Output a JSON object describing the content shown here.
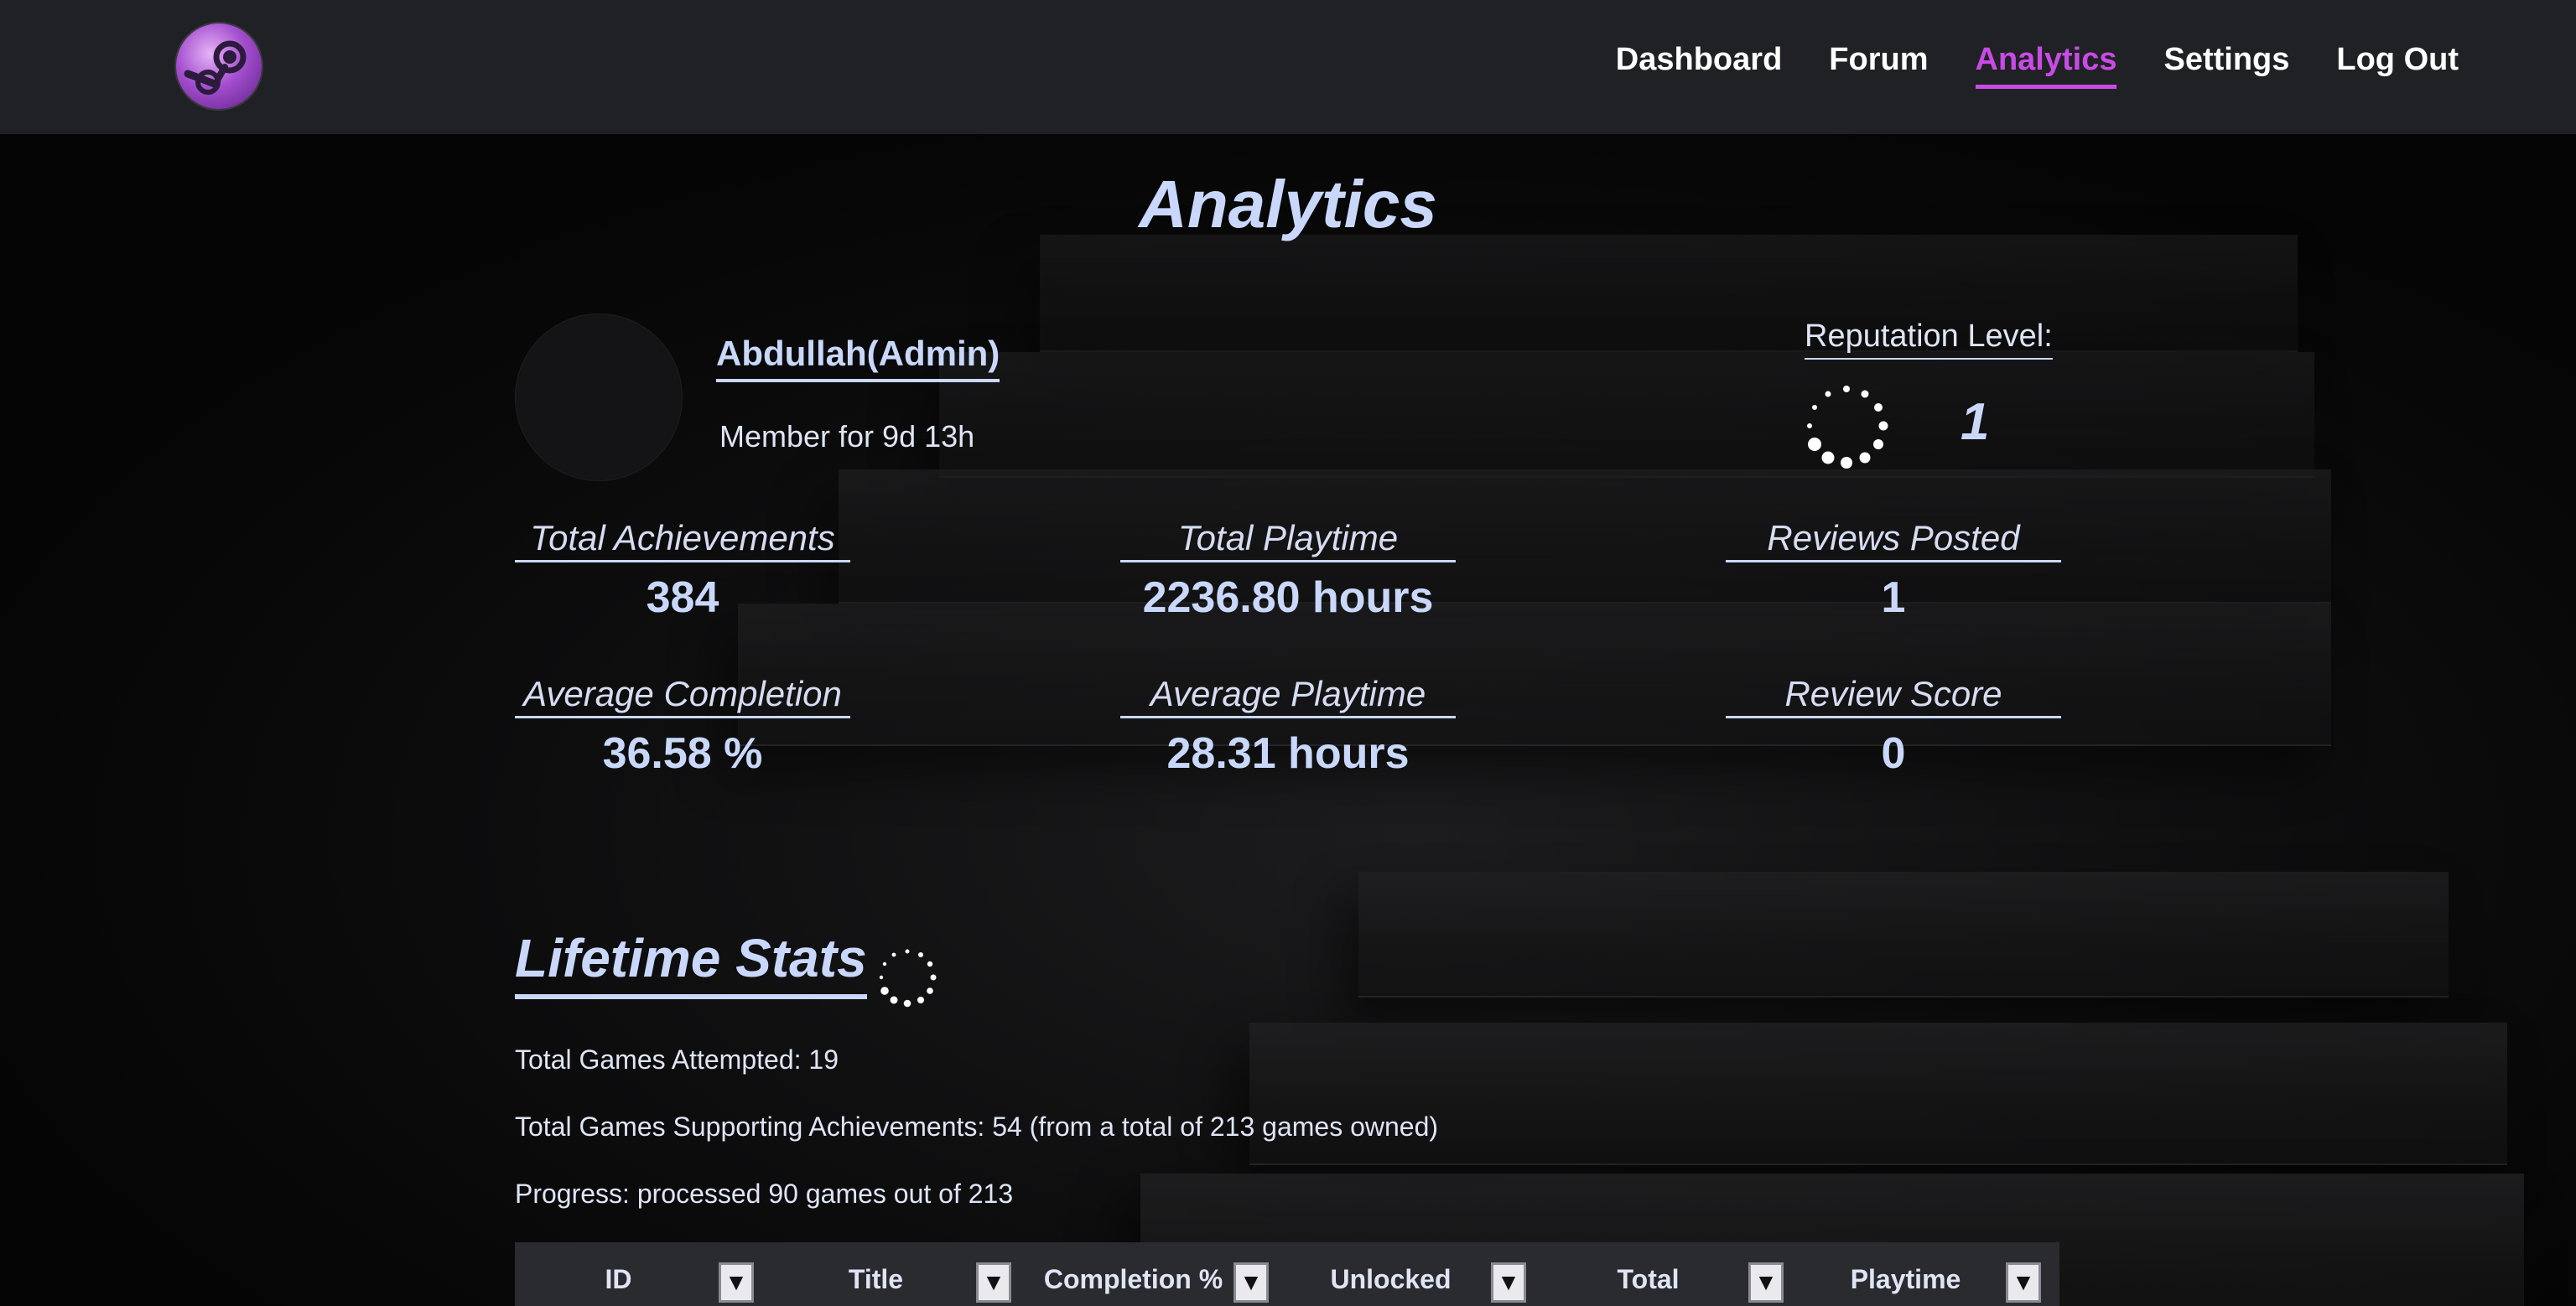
{
  "nav": {
    "logo_icon": "steam-logo-icon",
    "links": [
      "Dashboard",
      "Forum",
      "Analytics",
      "Settings",
      "Log Out"
    ],
    "active": "Analytics",
    "accent_color": "#c84be6"
  },
  "page": {
    "title": "Analytics"
  },
  "profile": {
    "username": "Abdullah(Admin)",
    "member_for": "Member for 9d 13h",
    "reputation_label": "Reputation Level:",
    "reputation_value": "1"
  },
  "stats": [
    {
      "label": "Total Achievements",
      "value": "384"
    },
    {
      "label": "Total Playtime",
      "value": "2236.80 hours"
    },
    {
      "label": "Reviews Posted",
      "value": "1"
    },
    {
      "label": "Average Completion",
      "value": "36.58 %"
    },
    {
      "label": "Average Playtime",
      "value": "28.31 hours"
    },
    {
      "label": "Review Score",
      "value": "0"
    }
  ],
  "lifetime": {
    "title": "Lifetime Stats",
    "games_attempted": "Total Games Attempted: 19",
    "games_supporting": "Total Games Supporting Achievements: 54 (from a total of 213 games owned)",
    "progress": "Progress: processed 90 games out of 213"
  },
  "table": {
    "columns": [
      "ID",
      "Title",
      "Completion %",
      "Unlocked",
      "Total",
      "Playtime"
    ],
    "sort_glyph": "▼"
  }
}
